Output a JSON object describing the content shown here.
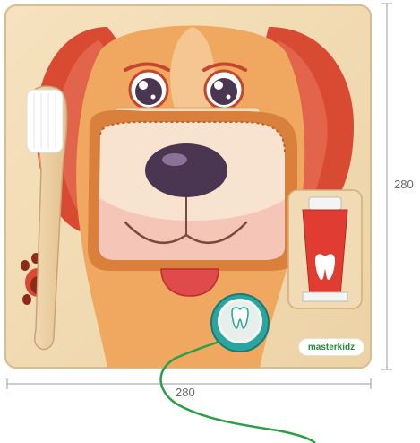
{
  "dimensions": {
    "width_label": "280",
    "height_label": "280"
  },
  "brand": {
    "name": "masterkidz"
  },
  "colors": {
    "board": "#f3dcb4",
    "dog_fur": "#f0a860",
    "ear": "#d94a32",
    "muzzle": "#f7e3cf",
    "nose": "#4a3650",
    "tongue": "#e04a4a",
    "fabric_edge": "#d9803c",
    "toothbrush": "#efd3a8",
    "bristles": "#ffffff",
    "toothpaste": "#e03c32",
    "floss_case": "#2aa6a0",
    "string": "#2e9e48"
  },
  "objects": [
    "toothbrush",
    "toothpaste",
    "dental-floss",
    "dog-face"
  ]
}
